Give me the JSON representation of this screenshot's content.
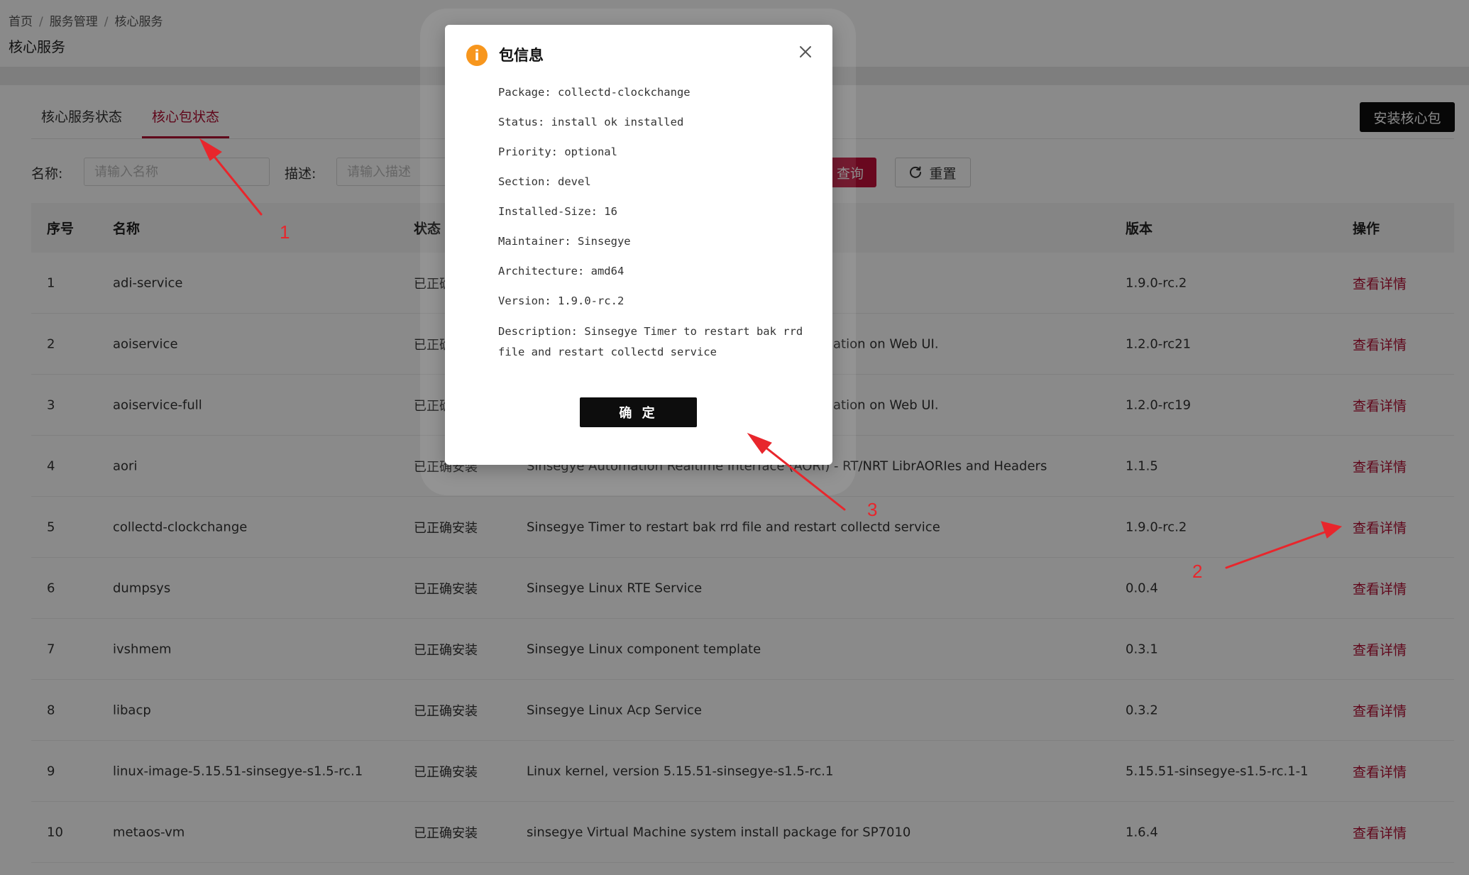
{
  "breadcrumb": [
    "首页",
    "服务管理",
    "核心服务"
  ],
  "page_title": "核心服务",
  "tabs": [
    {
      "label": "核心服务状态",
      "active": false
    },
    {
      "label": "核心包状态",
      "active": true
    }
  ],
  "install_button": "安装核心包",
  "filters": {
    "name_label": "名称:",
    "name_placeholder": "请输入名称",
    "desc_label": "描述:",
    "desc_placeholder": "请输入描述",
    "query_button": "查询",
    "reset_button": "重置"
  },
  "table": {
    "headers": [
      "序号",
      "名称",
      "状态",
      "版本",
      "操作"
    ],
    "rows": [
      {
        "idx": "1",
        "name": "adi-service",
        "status": "已正确",
        "desc": "",
        "version": "1.9.0-rc.2",
        "action": "查看详情"
      },
      {
        "idx": "2",
        "name": "aoiservice",
        "status": "已正确",
        "desc": "ation on Web UI.",
        "version": "1.2.0-rc21",
        "action": "查看详情"
      },
      {
        "idx": "3",
        "name": "aoiservice-full",
        "status": "已正确",
        "desc": "ation on Web UI.",
        "version": "1.2.0-rc19",
        "action": "查看详情"
      },
      {
        "idx": "4",
        "name": "aori",
        "status": "已正确安装",
        "desc": "Sinsegye Automation Realtime Interface (AORI) - RT/NRT LibrAORIes and Headers",
        "version": "1.1.5",
        "action": "查看详情"
      },
      {
        "idx": "5",
        "name": "collectd-clockchange",
        "status": "已正确安装",
        "desc": "Sinsegye Timer to restart bak rrd file and restart collectd service",
        "version": "1.9.0-rc.2",
        "action": "查看详情"
      },
      {
        "idx": "6",
        "name": "dumpsys",
        "status": "已正确安装",
        "desc": "Sinsegye Linux RTE Service",
        "version": "0.0.4",
        "action": "查看详情"
      },
      {
        "idx": "7",
        "name": "ivshmem",
        "status": "已正确安装",
        "desc": "Sinsegye Linux component template",
        "version": "0.3.1",
        "action": "查看详情"
      },
      {
        "idx": "8",
        "name": "libacp",
        "status": "已正确安装",
        "desc": "Sinsegye Linux Acp Service",
        "version": "0.3.2",
        "action": "查看详情"
      },
      {
        "idx": "9",
        "name": "linux-image-5.15.51-sinsegye-s1.5-rc.1",
        "status": "已正确安装",
        "desc": "Linux kernel, version 5.15.51-sinsegye-s1.5-rc.1",
        "version": "5.15.51-sinsegye-s1.5-rc.1-1",
        "action": "查看详情"
      },
      {
        "idx": "10",
        "name": "metaos-vm",
        "status": "已正确安装",
        "desc": "sinsegye Virtual Machine system install package for SP7010",
        "version": "1.6.4",
        "action": "查看详情"
      }
    ]
  },
  "modal": {
    "title": "包信息",
    "icon": "info-icon",
    "icon_glyph": "i",
    "lines": [
      "Package: collectd-clockchange",
      "Status: install ok installed",
      "Priority: optional",
      "Section: devel",
      "Installed-Size: 16",
      "Maintainer: Sinsegye",
      "Architecture: amd64",
      "Version: 1.9.0-rc.2",
      "Description: Sinsegye Timer to restart bak rrd file and restart collectd service"
    ],
    "confirm_button": "确 定"
  },
  "annotations": [
    "1",
    "2",
    "3"
  ],
  "colors": {
    "accent": "#b10d32",
    "annotation": "#e8262c",
    "info_icon": "#f7961d"
  }
}
